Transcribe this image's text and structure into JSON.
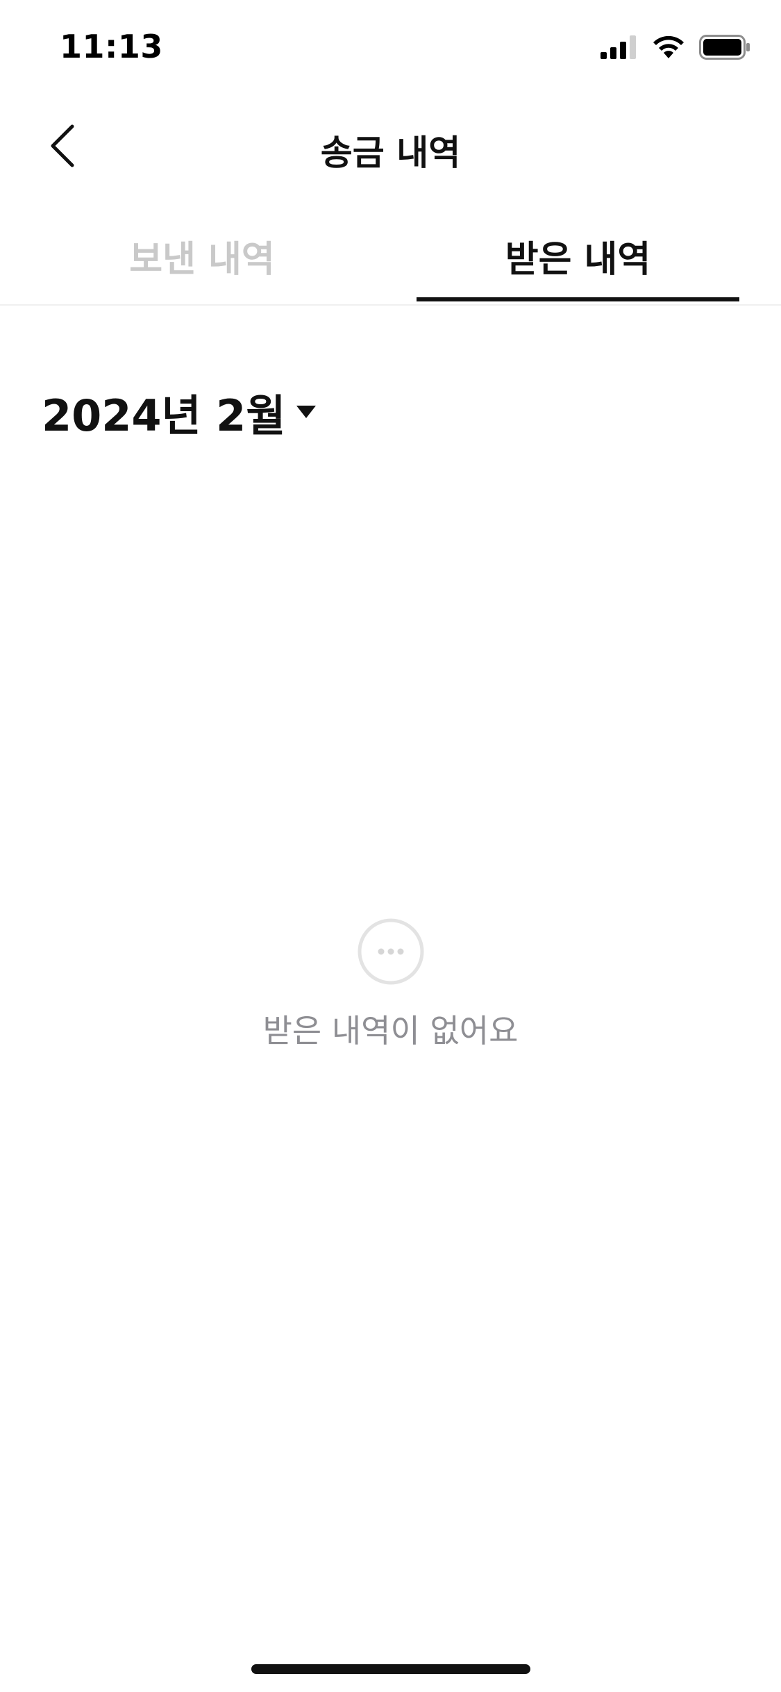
{
  "status_bar": {
    "time": "11:13"
  },
  "header": {
    "title": "송금 내역",
    "back_icon": "chevron-left-icon"
  },
  "tabs": [
    {
      "label": "보낸 내역",
      "selected": false
    },
    {
      "label": "받은 내역",
      "selected": true
    }
  ],
  "month_selector": {
    "label": "2024년 2월",
    "icon": "caret-down-icon"
  },
  "empty_state": {
    "icon": "ellipsis-circle-icon",
    "message": "받은 내역이 없어요"
  },
  "colors": {
    "text_primary": "#111111",
    "tab_inactive": "#c9c9c9",
    "empty_text": "#8e8e93",
    "divider": "#f0f0f0"
  }
}
